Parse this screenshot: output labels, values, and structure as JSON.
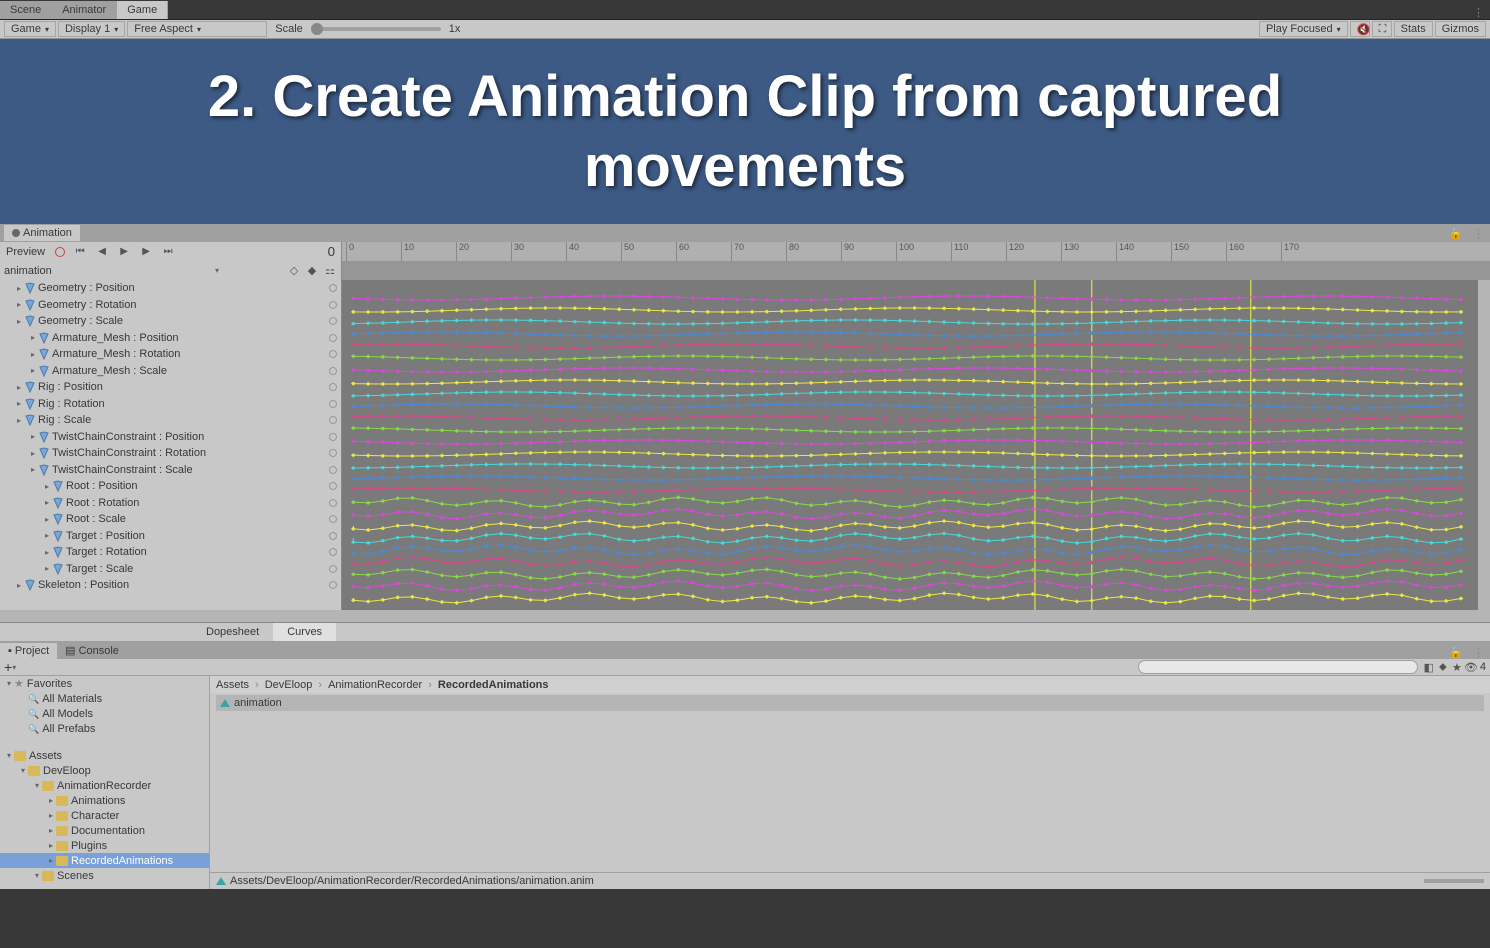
{
  "top_tabs": {
    "scene": "Scene",
    "animator": "Animator",
    "game": "Game"
  },
  "toolbar": {
    "mode": "Game",
    "display": "Display 1",
    "aspect": "Free Aspect",
    "scale_label": "Scale",
    "scale_value": "1x",
    "play_mode": "Play Focused",
    "stats": "Stats",
    "gizmos": "Gizmos"
  },
  "game_view": {
    "overlay_text": "2. Create Animation Clip from captured movements"
  },
  "anim": {
    "tab": "Animation",
    "preview": "Preview",
    "frame": "0",
    "clip_name": "animation",
    "ruler_ticks": [
      "0",
      "10",
      "20",
      "30",
      "40",
      "50",
      "60",
      "70",
      "80",
      "90",
      "100",
      "110",
      "120",
      "130",
      "140",
      "150",
      "160",
      "170"
    ],
    "properties": [
      {
        "indent": 0,
        "label": "Geometry : Position"
      },
      {
        "indent": 0,
        "label": "Geometry : Rotation"
      },
      {
        "indent": 0,
        "label": "Geometry : Scale"
      },
      {
        "indent": 1,
        "label": "Armature_Mesh : Position"
      },
      {
        "indent": 1,
        "label": "Armature_Mesh : Rotation"
      },
      {
        "indent": 1,
        "label": "Armature_Mesh : Scale"
      },
      {
        "indent": 0,
        "label": "Rig : Position"
      },
      {
        "indent": 0,
        "label": "Rig : Rotation"
      },
      {
        "indent": 0,
        "label": "Rig : Scale"
      },
      {
        "indent": 1,
        "label": "TwistChainConstraint : Position"
      },
      {
        "indent": 1,
        "label": "TwistChainConstraint : Rotation"
      },
      {
        "indent": 1,
        "label": "TwistChainConstraint : Scale"
      },
      {
        "indent": 2,
        "label": "Root : Position"
      },
      {
        "indent": 2,
        "label": "Root : Rotation"
      },
      {
        "indent": 2,
        "label": "Root : Scale"
      },
      {
        "indent": 2,
        "label": "Target : Position"
      },
      {
        "indent": 2,
        "label": "Target : Rotation"
      },
      {
        "indent": 2,
        "label": "Target : Scale"
      },
      {
        "indent": 0,
        "label": "Skeleton : Position"
      }
    ],
    "bottom_tabs": {
      "dope": "Dopesheet",
      "curves": "Curves"
    }
  },
  "project": {
    "tab_project": "Project",
    "tab_console": "Console",
    "tree": [
      {
        "indent": 0,
        "type": "fav",
        "label": "Favorites",
        "open": true
      },
      {
        "indent": 1,
        "type": "search",
        "label": "All Materials"
      },
      {
        "indent": 1,
        "type": "search",
        "label": "All Models"
      },
      {
        "indent": 1,
        "type": "search",
        "label": "All Prefabs"
      },
      {
        "indent": 0,
        "type": "folder",
        "label": "Assets",
        "open": true
      },
      {
        "indent": 1,
        "type": "folder",
        "label": "DevEloop",
        "open": true
      },
      {
        "indent": 2,
        "type": "folder",
        "label": "AnimationRecorder",
        "open": true
      },
      {
        "indent": 3,
        "type": "folder",
        "label": "Animations"
      },
      {
        "indent": 3,
        "type": "folder",
        "label": "Character"
      },
      {
        "indent": 3,
        "type": "folder",
        "label": "Documentation"
      },
      {
        "indent": 3,
        "type": "folder",
        "label": "Plugins"
      },
      {
        "indent": 3,
        "type": "folder",
        "label": "RecordedAnimations",
        "sel": true
      },
      {
        "indent": 2,
        "type": "folder",
        "label": "Scenes",
        "open": true
      }
    ],
    "breadcrumb": [
      "Assets",
      "DevEloop",
      "AnimationRecorder",
      "RecordedAnimations"
    ],
    "asset": "animation",
    "status_path": "Assets/DevEloop/AnimationRecorder/RecordedAnimations/animation.anim",
    "slider_count": "4"
  }
}
